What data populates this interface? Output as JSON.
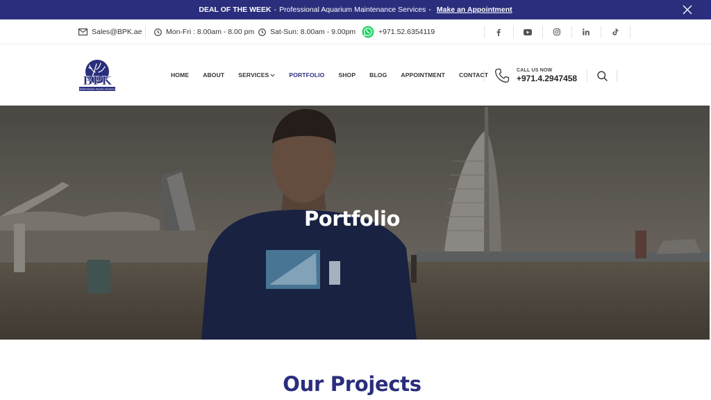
{
  "promo": {
    "label": "DEAL OF THE WEEK",
    "separator": "-",
    "text": "Professional Aquarium Maintenance Services",
    "separator2": "-",
    "cta": "Make an Appointment"
  },
  "contact": {
    "email": "Sales@BPK.ae",
    "weekday_hours": "Mon-Fri : 8.00am - 8.00 pm",
    "weekend_hours": "Sat-Sun: 8.00am - 9.00pm",
    "whatsapp": "+971.52.6354119"
  },
  "social": [
    "facebook-icon",
    "youtube-icon",
    "instagram-icon",
    "linkedin-icon",
    "tiktok-icon"
  ],
  "logo": {
    "text": "BPK",
    "tagline": "Bottomfeeder Aquatic Solutions"
  },
  "nav": {
    "items": [
      {
        "label": "HOME"
      },
      {
        "label": "ABOUT"
      },
      {
        "label": "SERVICES"
      },
      {
        "label": "PORTFOLIO"
      },
      {
        "label": "SHOP"
      },
      {
        "label": "BLOG"
      },
      {
        "label": "APPOINTMENT"
      },
      {
        "label": "CONTACT"
      }
    ]
  },
  "call": {
    "label": "CALL US NOW",
    "number": "+971.4.2947458"
  },
  "hero": {
    "title": "Portfolio"
  },
  "section": {
    "title": "Our Projects"
  },
  "colors": {
    "brand": "#2a2e7c",
    "promo_bg": "#2a2e7c",
    "whatsapp": "#25d366"
  }
}
